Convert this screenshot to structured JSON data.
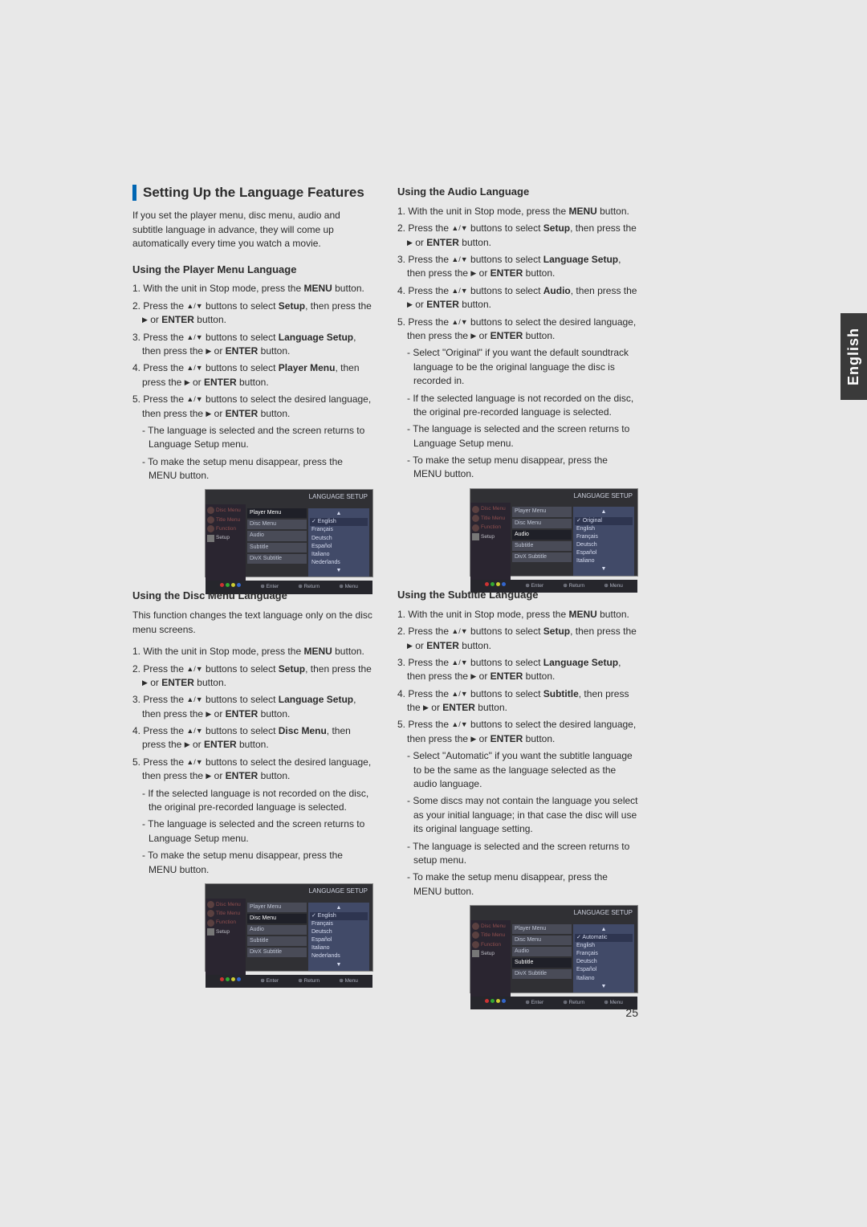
{
  "sidetab": "English",
  "page_number": "25",
  "main_title": "Setting Up the Language Features",
  "intro": "If you set the player menu, disc menu, audio and subtitle language in advance, they will come up automatically every time you watch a movie.",
  "osd_common": {
    "title": "LANGUAGE SETUP",
    "side": [
      "Disc Menu",
      "Title Menu",
      "Function",
      "Setup"
    ],
    "mid": [
      "Player Menu",
      "Disc Menu",
      "Audio",
      "Subtitle",
      "DivX Subtitle"
    ],
    "foot": [
      "Enter",
      "Return",
      "Menu"
    ]
  },
  "sections": {
    "player_menu": {
      "title": "Using the Player Menu Language",
      "steps": [
        "With the unit in Stop mode, press the <b>MENU</b> button.",
        "Press the [UD] buttons to select <b>Setup</b>, then press the [R] or <b>ENTER</b> button.",
        "Press the [UD] buttons to select <b>Language Setup</b>, then press the [R] or <b>ENTER</b> button.",
        "Press the [UD] buttons to select <b>Player Menu</b>, then press the [R] or <b>ENTER</b> button.",
        "Press the [UD] buttons to select the desired language, then press the [R] or <b>ENTER</b> button."
      ],
      "subnotes": [
        "The language is selected and the screen returns to Language Setup menu.",
        "To make the setup menu disappear, press the MENU button."
      ],
      "osd": {
        "highlight": 0,
        "options": [
          "English",
          "Français",
          "Deutsch",
          "Español",
          "Italiano",
          "Nederlands"
        ],
        "sel": 0
      }
    },
    "disc_menu": {
      "title": "Using the Disc Menu Language",
      "intro": "This function changes the text language only on the disc menu screens.",
      "steps": [
        "With the unit in Stop mode, press the <b>MENU</b> button.",
        "Press the [UD] buttons to select <b>Setup</b>, then press the [R] or <b>ENTER</b> button.",
        "Press the [UD] buttons to select <b>Language Setup</b>, then press the [R] or <b>ENTER</b> button.",
        "Press the [UD] buttons to select <b>Disc Menu</b>, then press the [R] or <b>ENTER</b> button.",
        "Press the [UD] buttons to select the desired language, then press the [R] or <b>ENTER</b> button."
      ],
      "subnotes": [
        "If the selected language is not recorded on  the disc, the original pre-recorded language is selected.",
        "The language is selected and the screen returns to Language Setup menu.",
        "To make the setup menu disappear, press the MENU button."
      ],
      "osd": {
        "highlight": 1,
        "options": [
          "English",
          "Français",
          "Deutsch",
          "Español",
          "Italiano",
          "Nederlands"
        ],
        "sel": 0
      }
    },
    "audio": {
      "title": "Using the Audio Language",
      "steps": [
        "With the unit in Stop mode, press the <b>MENU</b> button.",
        "Press the [UD] buttons to select <b>Setup</b>, then press the [R] or <b>ENTER</b> button.",
        "Press the [UD] buttons to select <b>Language Setup</b>, then press the [R] or <b>ENTER</b> button.",
        "Press the [UD] buttons to select <b>Audio</b>, then press the [R] or <b>ENTER</b> button.",
        "Press the [UD] buttons to select the desired language, then press the [R] or <b>ENTER</b> button."
      ],
      "subnotes": [
        "Select \"Original\" if you want the default soundtrack language to be the original language the disc is recorded in.",
        "If the selected language is not recorded on the disc, the original pre-recorded language is selected.",
        "The language is selected and the screen returns to Language Setup menu.",
        "To make the setup menu disappear, press the MENU button."
      ],
      "osd": {
        "highlight": 2,
        "options": [
          "Original",
          "English",
          "Français",
          "Deutsch",
          "Español",
          "Italiano"
        ],
        "sel": 0
      }
    },
    "subtitle": {
      "title": "Using the Subtitle Language",
      "steps": [
        "With the unit in Stop mode, press the <b>MENU</b> button.",
        "Press the [UD] buttons to select <b>Setup</b>, then press the [R] or <b>ENTER</b> button.",
        "Press the [UD] buttons to select <b>Language Setup</b>, then press the [R] or <b>ENTER</b> button.",
        "Press the [UD] buttons to select <b>Subtitle</b>, then press the [R] or <b>ENTER</b> button.",
        "Press the [UD] buttons to select the desired  language, then press the [R] or <b>ENTER</b> button."
      ],
      "subnotes": [
        "Select \"Automatic\" if you want the subtitle  language to be the same as the language selected as the audio language.",
        "Some discs may not contain the language you select as your initial language; in that case the disc will use its original language setting.",
        "The language is selected and the screen returns to setup menu.",
        "To make the setup menu disappear, press the MENU button."
      ],
      "osd": {
        "highlight": 3,
        "options": [
          "Automatic",
          "English",
          "Français",
          "Deutsch",
          "Español",
          "Italiano"
        ],
        "sel": 0
      }
    }
  }
}
